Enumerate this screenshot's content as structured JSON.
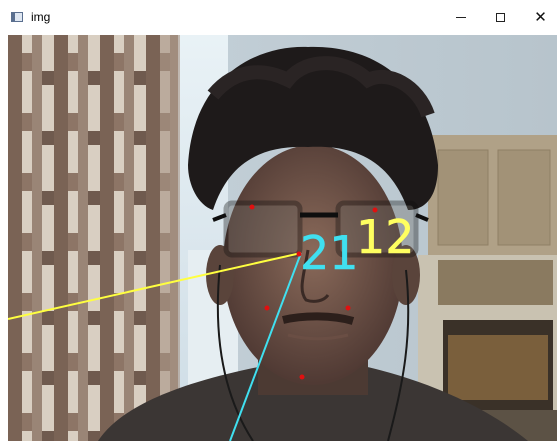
{
  "window": {
    "title": "img",
    "controls": {
      "minimize_icon": "minimize-icon",
      "maximize_icon": "maximize-icon",
      "close_icon": "close-icon",
      "close_glyph": "✕"
    }
  },
  "image": {
    "overlay_text_cyan": "21",
    "overlay_text_yellow": "12",
    "colors": {
      "yellow_line": "#ffff40",
      "cyan_line": "#40e0f0",
      "landmark": "#e01010"
    },
    "landmark_count": 6
  }
}
